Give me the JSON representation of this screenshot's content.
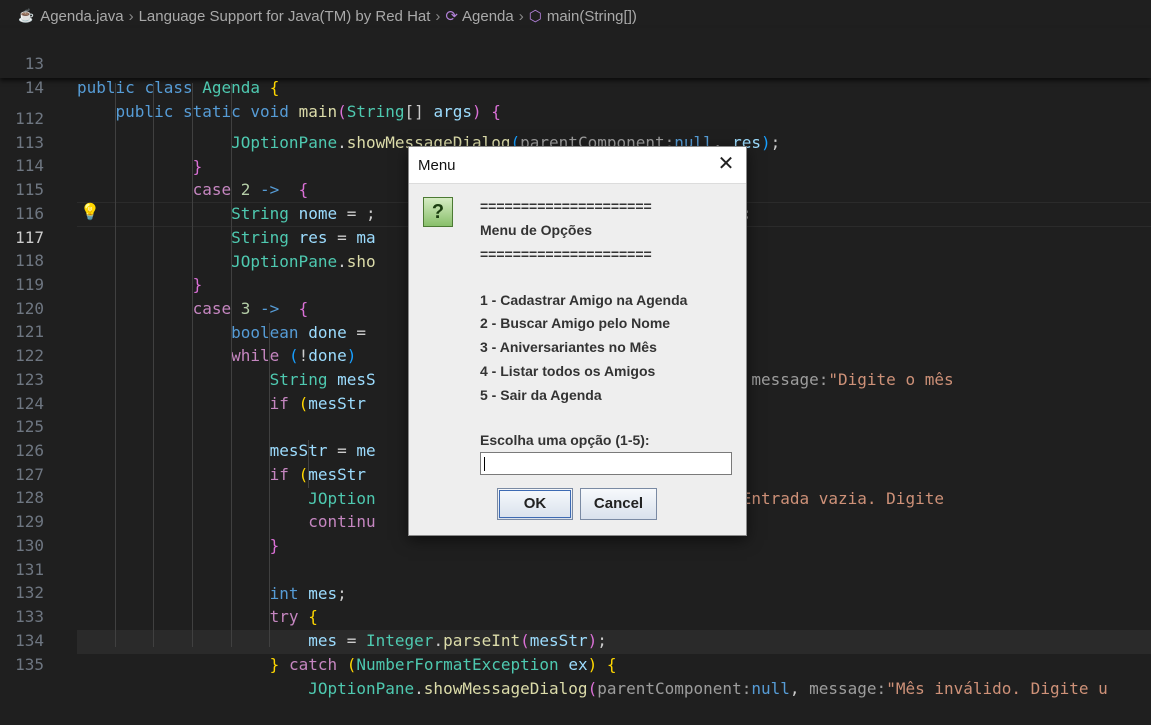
{
  "breadcrumb": {
    "items": [
      {
        "icon": "java-file-icon",
        "label": "Agenda.java"
      },
      {
        "label": "Language Support for Java(TM) by Red Hat"
      },
      {
        "icon": "class-symbol-icon",
        "label": "Agenda"
      },
      {
        "icon": "method-symbol-icon",
        "label": "main(String[])"
      }
    ]
  },
  "sticky": [
    {
      "num": "13",
      "code": "public class Agenda {"
    },
    {
      "num": "14",
      "code": "    public static void main(String[] args) {"
    }
  ],
  "code_lines": [
    {
      "num": "112",
      "code": "JOptionPane.showMessageDialog(parentComponent:null, res);"
    },
    {
      "num": "113",
      "code": "}"
    },
    {
      "num": "114",
      "code": "case 2 ->  {"
    },
    {
      "num": "115",
      "code": "String nome = ... \"Nome para buscar:\");"
    },
    {
      "num": "116",
      "code": "String res = ma..."
    },
    {
      "num": "117",
      "code": "JOptionPane.sho... , res);"
    },
    {
      "num": "118",
      "code": "}"
    },
    {
      "num": "119",
      "code": "case 3 ->  {"
    },
    {
      "num": "120",
      "code": "boolean done = ..."
    },
    {
      "num": "121",
      "code": "while (!done) ..."
    },
    {
      "num": "122",
      "code": "String mesS... arentComponent:null, message:\"Digite o mês"
    },
    {
      "num": "123",
      "code": "if (mesStr ..."
    },
    {
      "num": "124",
      "code": ""
    },
    {
      "num": "125",
      "code": "mesStr = me..."
    },
    {
      "num": "126",
      "code": "if (mesStr..."
    },
    {
      "num": "127",
      "code": "JOption... nent:null, message:\"Entrada vazia. Digite"
    },
    {
      "num": "128",
      "code": "continu..."
    },
    {
      "num": "129",
      "code": "}"
    },
    {
      "num": "130",
      "code": ""
    },
    {
      "num": "131",
      "code": "int mes;"
    },
    {
      "num": "132",
      "code": "try {"
    },
    {
      "num": "133",
      "code": "mes = Integer.parseInt(mesStr);"
    },
    {
      "num": "134",
      "code": "} catch (NumberFormatException ex) {"
    },
    {
      "num": "135",
      "code": "JOptionPane.showMessageDialog(parentComponent:null, message:\"Mês inválido. Digite u"
    }
  ],
  "active_line": "117",
  "dialog": {
    "title": "Menu",
    "close_label": "✕",
    "icon_label": "?",
    "lines": [
      "=====================",
      "Menu de Opções",
      "=====================",
      "",
      "1 - Cadastrar Amigo na Agenda",
      "2 - Buscar Amigo pelo Nome",
      "3 - Aniversariantes no Mês",
      "4 - Listar todos os Amigos",
      "5 - Sair da Agenda",
      "",
      "Escolha uma opção (1-5):"
    ],
    "input_value": "",
    "ok_label": "OK",
    "cancel_label": "Cancel"
  },
  "colors": {
    "editor_bg": "#1f1f1f",
    "keyword": "#569cd6",
    "control": "#c586c0",
    "type": "#4ec9b0",
    "string": "#ce9178",
    "dialog_bg": "#eeeeee"
  }
}
